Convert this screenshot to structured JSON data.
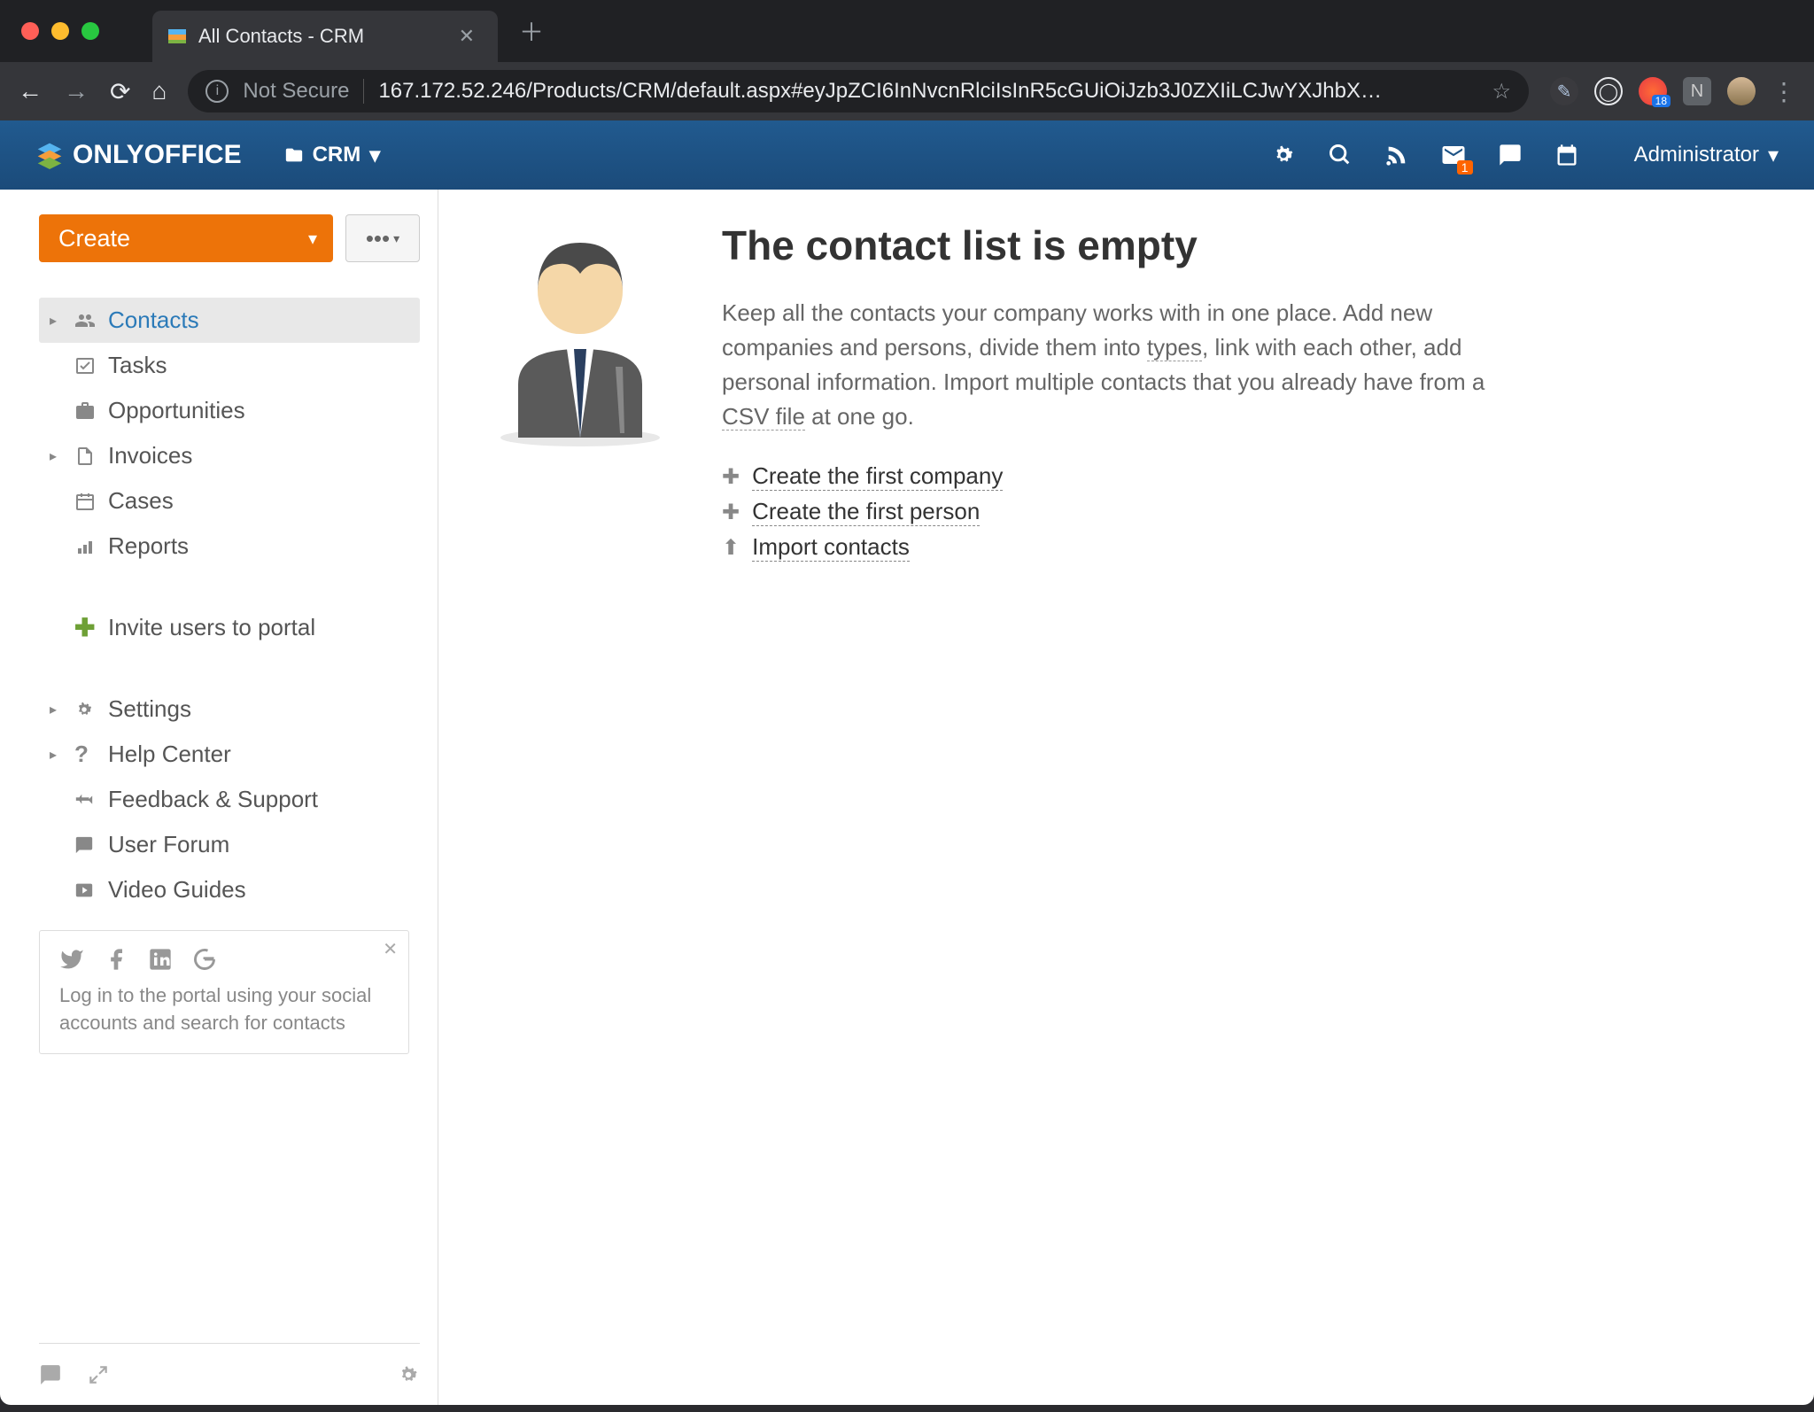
{
  "browser": {
    "tab_title": "All Contacts - CRM",
    "url_security": "Not Secure",
    "url": "167.172.52.246/Products/CRM/default.aspx#eyJpZCI6InNvcnRlciIsInR5cGUiOiJzb3J0ZXIiLCJwYXJhbX…",
    "ext_badge": "18"
  },
  "header": {
    "brand": "ONLYOFFICE",
    "module": "CRM",
    "mail_badge": "1",
    "user": "Administrator"
  },
  "sidebar": {
    "create": "Create",
    "more": "•••",
    "items": [
      {
        "label": "Contacts"
      },
      {
        "label": "Tasks"
      },
      {
        "label": "Opportunities"
      },
      {
        "label": "Invoices"
      },
      {
        "label": "Cases"
      },
      {
        "label": "Reports"
      }
    ],
    "invite": "Invite users to portal",
    "settings": "Settings",
    "help": "Help Center",
    "feedback": "Feedback & Support",
    "forum": "User Forum",
    "video": "Video Guides",
    "social_text": "Log in to the portal using your social accounts and search for contacts"
  },
  "empty": {
    "title": "The contact list is empty",
    "text_1": "Keep all the contacts your company works with in one place. Add new companies and persons, divide them into ",
    "text_types": "types",
    "text_2": ", link with each other, add personal information. Import multiple contacts that you already have from a ",
    "text_csv": "CSV file",
    "text_3": " at one go.",
    "link_company": "Create the first company",
    "link_person": "Create the first person",
    "link_import": "Import contacts"
  }
}
